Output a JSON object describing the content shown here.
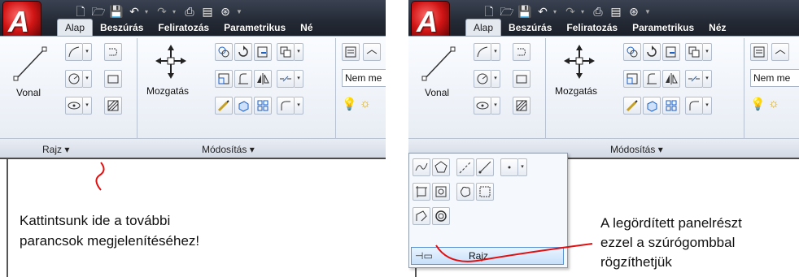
{
  "left": {
    "tabs": [
      "Alap",
      "Beszúrás",
      "Feliratozás",
      "Parametrikus",
      "Né"
    ],
    "active_tab": "Alap",
    "draw_big_button": "Vonal",
    "move_big_button": "Mozgatás",
    "layer_combo": "Nem me",
    "panel_draw_label": "Rajz ▾",
    "panel_modify_label": "Módosítás ▾",
    "note_line1": "Kattintsunk ide a  további",
    "note_line2": "parancsok megjelenítéséhez!"
  },
  "right": {
    "tabs": [
      "Alap",
      "Beszúrás",
      "Feliratozás",
      "Parametrikus",
      "Néz"
    ],
    "active_tab": "Alap",
    "draw_big_button": "Vonal",
    "move_big_button": "Mozgatás",
    "layer_combo": "Nem me",
    "panel_modify_label": "Módosítás ▾",
    "flyout_title": "Rajz",
    "note_line1": "A legördített panelrészt",
    "note_line2": "ezzel a szúrógombbal",
    "note_line3": "rögzíthetjük"
  },
  "colors": {
    "annotation_red": "#e01010",
    "ribbon_dark": "#242a35",
    "pin_highlight": "#c7e0fa"
  }
}
